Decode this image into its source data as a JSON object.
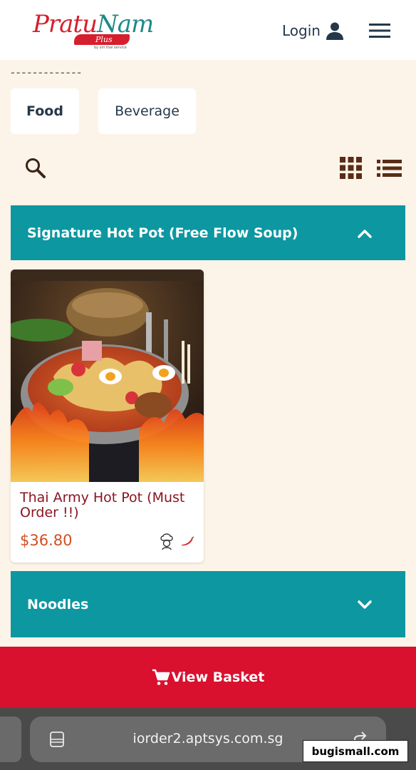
{
  "header": {
    "logo": {
      "main_part1": "Pratu",
      "main_part2": "Nam",
      "badge": "Plus",
      "tagline": "by siri thai service"
    },
    "login_label": "Login"
  },
  "divider": "-------------",
  "tabs": [
    {
      "label": "Food",
      "selected": true
    },
    {
      "label": "Beverage",
      "selected": false
    }
  ],
  "icons": {
    "search": "search-icon",
    "grid_view": "grid-view-icon",
    "list_view": "list-view-icon"
  },
  "sections": [
    {
      "title": "Signature Hot Pot (Free Flow Soup)",
      "expanded": true
    },
    {
      "title": "Noodles",
      "expanded": false
    }
  ],
  "products": [
    {
      "name": "Thai Army Hot Pot (Must Order !!)",
      "price": "$36.80",
      "badges": [
        "chef-icon",
        "chili-icon"
      ]
    }
  ],
  "basket": {
    "label": "View Basket"
  },
  "browser": {
    "url": "iorder2.aptsys.com.sg"
  },
  "watermark": "bugismall.com",
  "colors": {
    "background": "#fcf4e8",
    "section_bar": "#0d97a1",
    "basket": "#d9102e",
    "product_name": "#8a1420",
    "price": "#d24f22"
  }
}
